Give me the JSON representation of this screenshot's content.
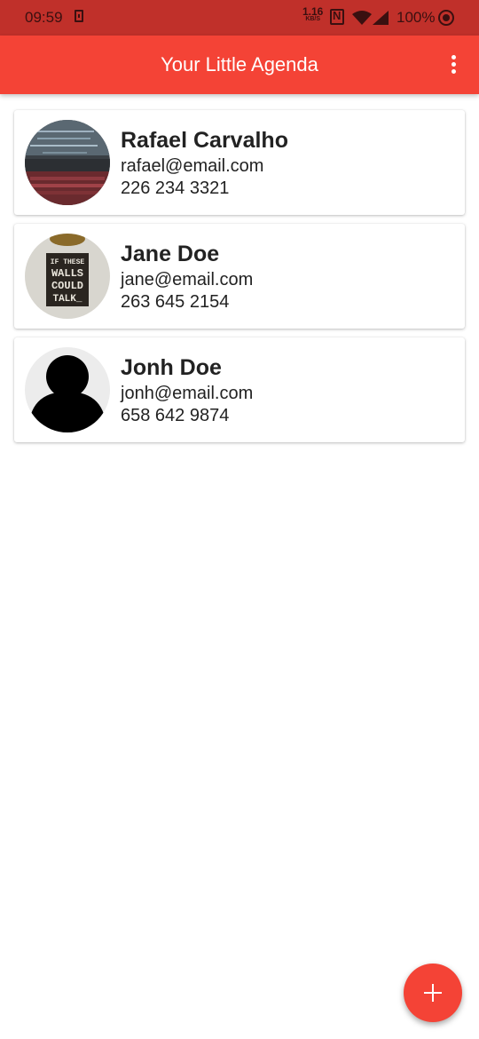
{
  "status_bar": {
    "time": "09:59",
    "net_speed_value": "1.16",
    "net_speed_unit": "KB/S",
    "battery": "100%",
    "icons": [
      "sim-icon",
      "nfc-icon",
      "wifi-icon",
      "signal-icon",
      "sync-icon"
    ]
  },
  "app_bar": {
    "title": "Your Little Agenda",
    "menu_icon": "more-vert-icon",
    "color": "#f44336"
  },
  "contacts": [
    {
      "name": "Rafael Carvalho",
      "email": "rafael@email.com",
      "phone": "226 234 3321",
      "avatar": "photo-laptop"
    },
    {
      "name": "Jane Doe",
      "email": "jane@email.com",
      "phone": "263 645 2154",
      "avatar": "photo-sign",
      "avatar_text": "IF THESE WALLS COULD TALK_"
    },
    {
      "name": "Jonh Doe",
      "email": "jonh@email.com",
      "phone": "658 642 9874",
      "avatar": "person-silhouette"
    }
  ],
  "fab": {
    "icon": "plus-icon",
    "color": "#f44336"
  }
}
